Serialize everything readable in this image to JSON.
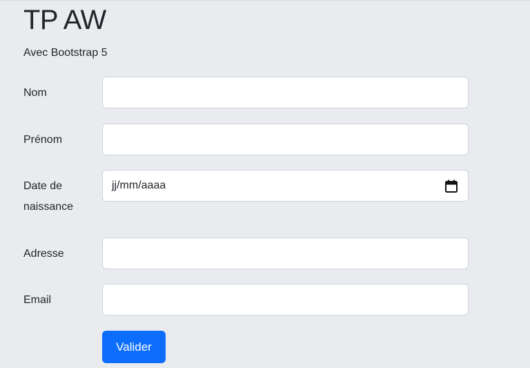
{
  "header": {
    "title": "TP AW",
    "subtitle": "Avec Bootstrap 5"
  },
  "form": {
    "nom": {
      "label": "Nom",
      "value": ""
    },
    "prenom": {
      "label": "Prénom",
      "value": ""
    },
    "date_naissance": {
      "label_line1": "Date de",
      "label_line2": "naissance",
      "placeholder": "jj/mm/aaaa",
      "icon": "calendar-icon"
    },
    "adresse": {
      "label": "Adresse",
      "value": ""
    },
    "email": {
      "label": "Email",
      "value": ""
    },
    "submit_label": "Valider"
  },
  "colors": {
    "background": "#e9ebef",
    "button": "#0d6efd",
    "input_border": "#ced4da"
  }
}
